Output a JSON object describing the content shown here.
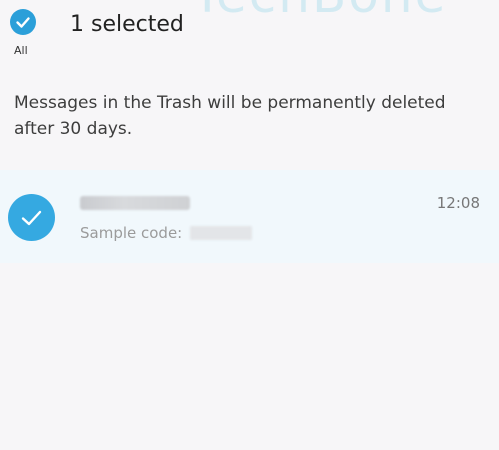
{
  "header": {
    "select_all_label": "All",
    "selected_count": "1 selected"
  },
  "notice": "Messages in the Trash will be permanently deleted after 30 days.",
  "messages": [
    {
      "preview_label": "Sample code:",
      "time": "12:08",
      "selected": true
    }
  ],
  "colors": {
    "accent": "#2b9fd9",
    "row_highlight": "#f1f8fc",
    "background": "#f7f6f8"
  },
  "icons": {
    "select_all": "check-circle-icon",
    "row_selected": "check-circle-icon"
  }
}
